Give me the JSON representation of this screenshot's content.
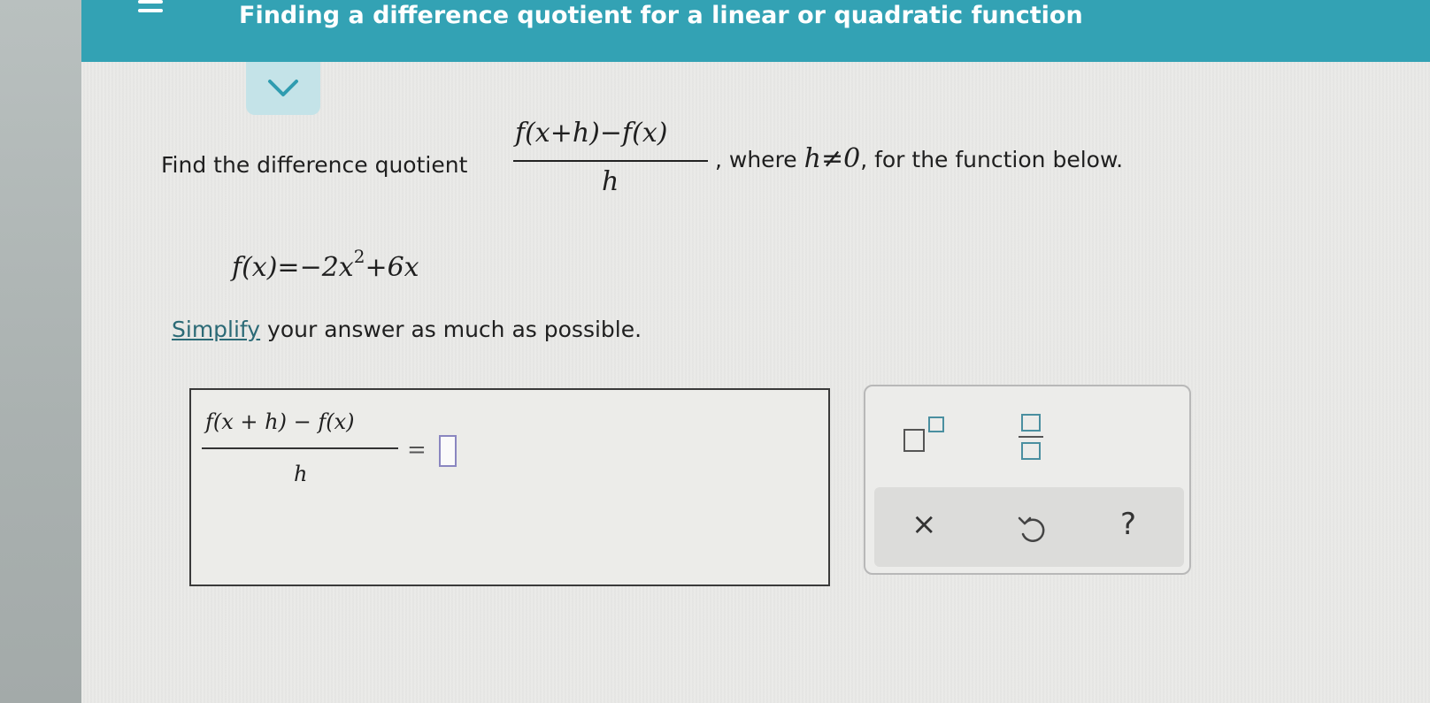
{
  "header": {
    "title": "Finding a difference quotient for a linear or quadratic function"
  },
  "problem": {
    "intro": "Find the difference quotient",
    "quotient_numerator": "f(x+h)−f(x)",
    "quotient_denominator": "h",
    "condition_prefix": ", where",
    "condition_math": "h≠0",
    "condition_suffix": ", for the function below.",
    "function_lhs": "f(x)=−2x",
    "function_exp": "2",
    "function_rhs": "+6x",
    "simplify_link": "Simplify",
    "simplify_rest": " your answer as much as possible."
  },
  "answer": {
    "numerator": "f(x + h) − f(x)",
    "denominator": "h",
    "equals": "="
  },
  "toolbar": {
    "clear": "×",
    "help": "?"
  }
}
